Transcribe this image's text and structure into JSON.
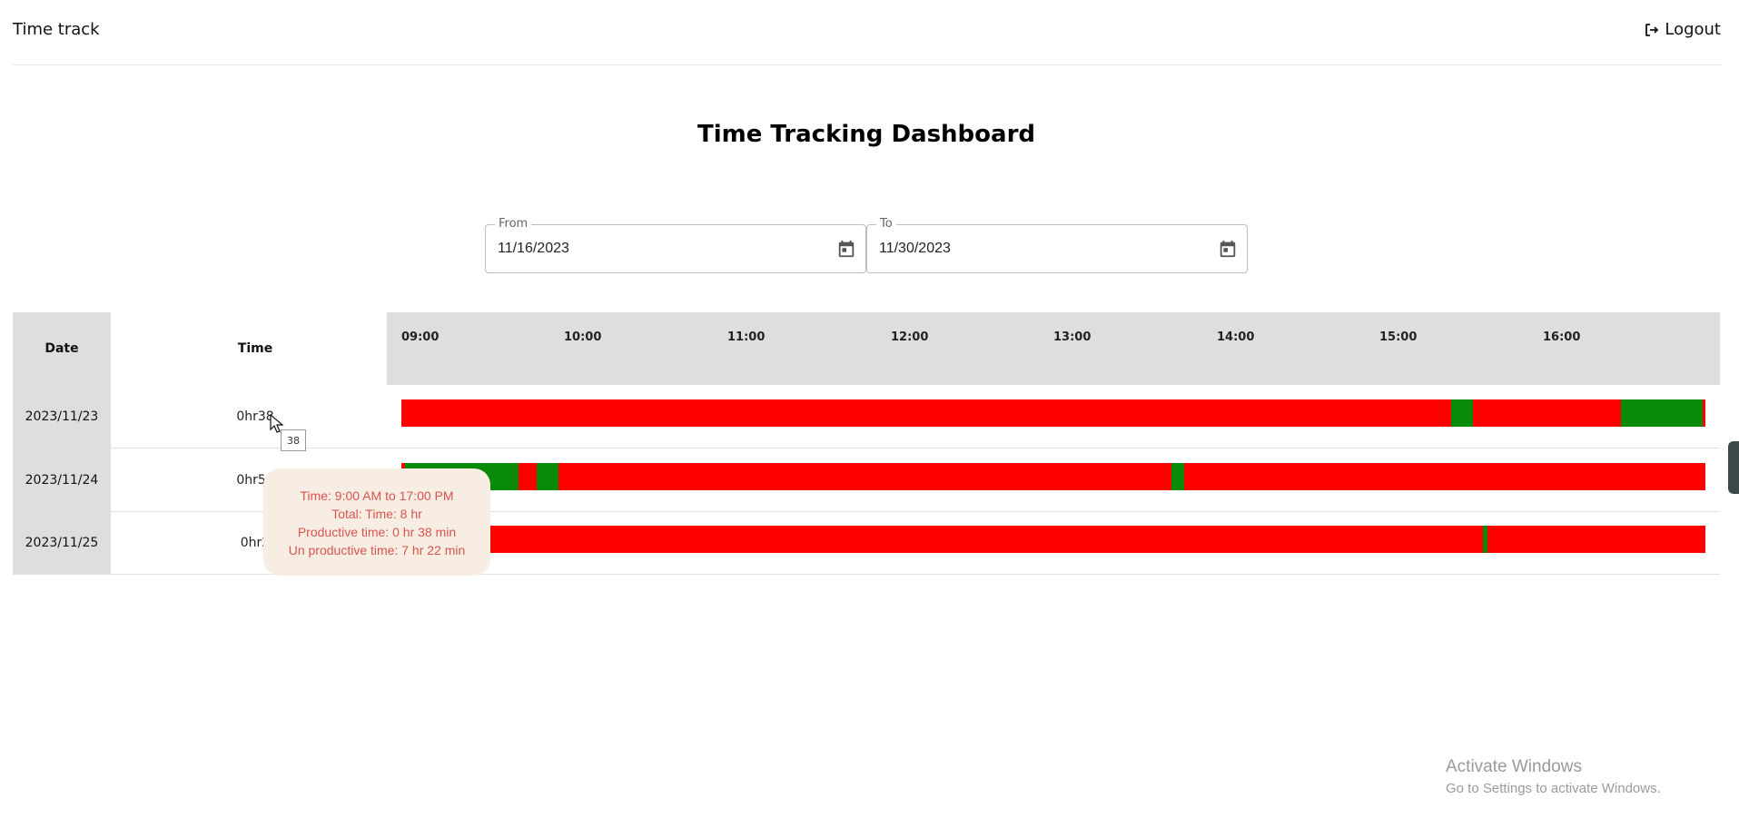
{
  "header": {
    "app_title": "Time track",
    "logout_label": "Logout"
  },
  "page_title": "Time Tracking Dashboard",
  "filters": {
    "from": {
      "label": "From",
      "value": "11/16/2023"
    },
    "to": {
      "label": "To",
      "value": "11/30/2023"
    }
  },
  "table": {
    "headers": {
      "date": "Date",
      "time": "Time"
    },
    "ticks": [
      "09:00",
      "10:00",
      "11:00",
      "12:00",
      "13:00",
      "14:00",
      "15:00",
      "16:00"
    ],
    "rows": [
      {
        "date": "2023/11/23",
        "time": "0hr38"
      },
      {
        "date": "2023/11/24",
        "time": "0hr56"
      },
      {
        "date": "2023/11/25",
        "time": "0hr2"
      }
    ]
  },
  "hover_value": "38",
  "tooltip": {
    "line1": "Time: 9:00 AM to 17:00 PM",
    "line2": "Total: Time: 8 hr",
    "line3": "Productive time: 0 hr 38 min",
    "line4": "Un productive time: 7 hr 22 min"
  },
  "colors": {
    "productive": "#0a8a0a",
    "unproductive": "#ff0000"
  },
  "watermark": {
    "title": "Activate Windows",
    "subtitle": "Go to Settings to activate Windows."
  }
}
